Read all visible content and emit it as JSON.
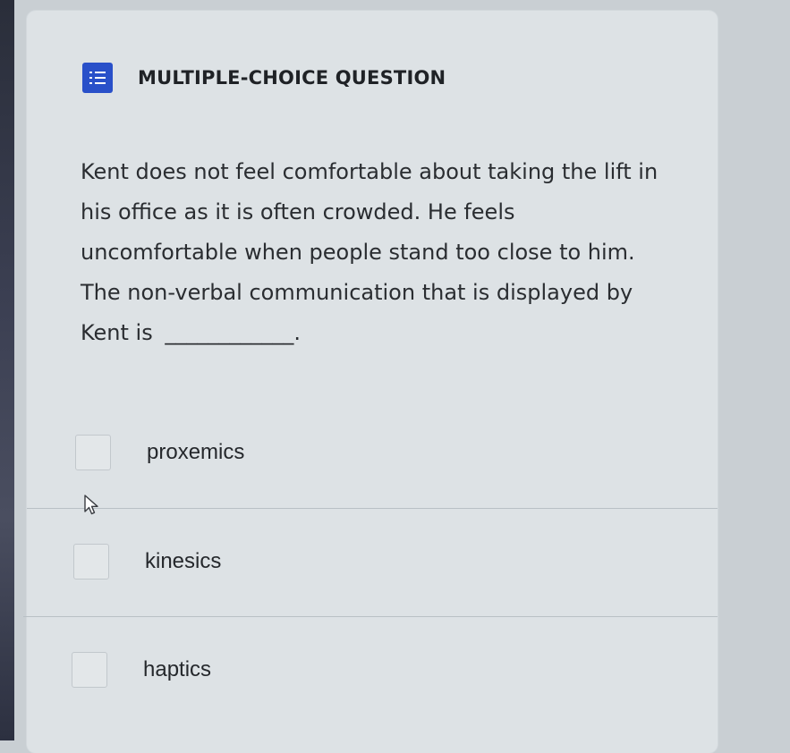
{
  "question_card": {
    "type_label": "MULTIPLE-CHOICE QUESTION",
    "type_icon": "numbered-list-icon",
    "accent_color": "#2950c9",
    "question_text": "Kent does not feel comfortable about taking the lift in his office as it is often crowded. He feels uncomfortable when people stand too close to him. The non-verbal communication that is displayed by Kent is",
    "question_blank": "____________.",
    "options": [
      {
        "label": "proxemics",
        "checked": false
      },
      {
        "label": "kinesics",
        "checked": false
      },
      {
        "label": "haptics",
        "checked": false
      }
    ]
  }
}
